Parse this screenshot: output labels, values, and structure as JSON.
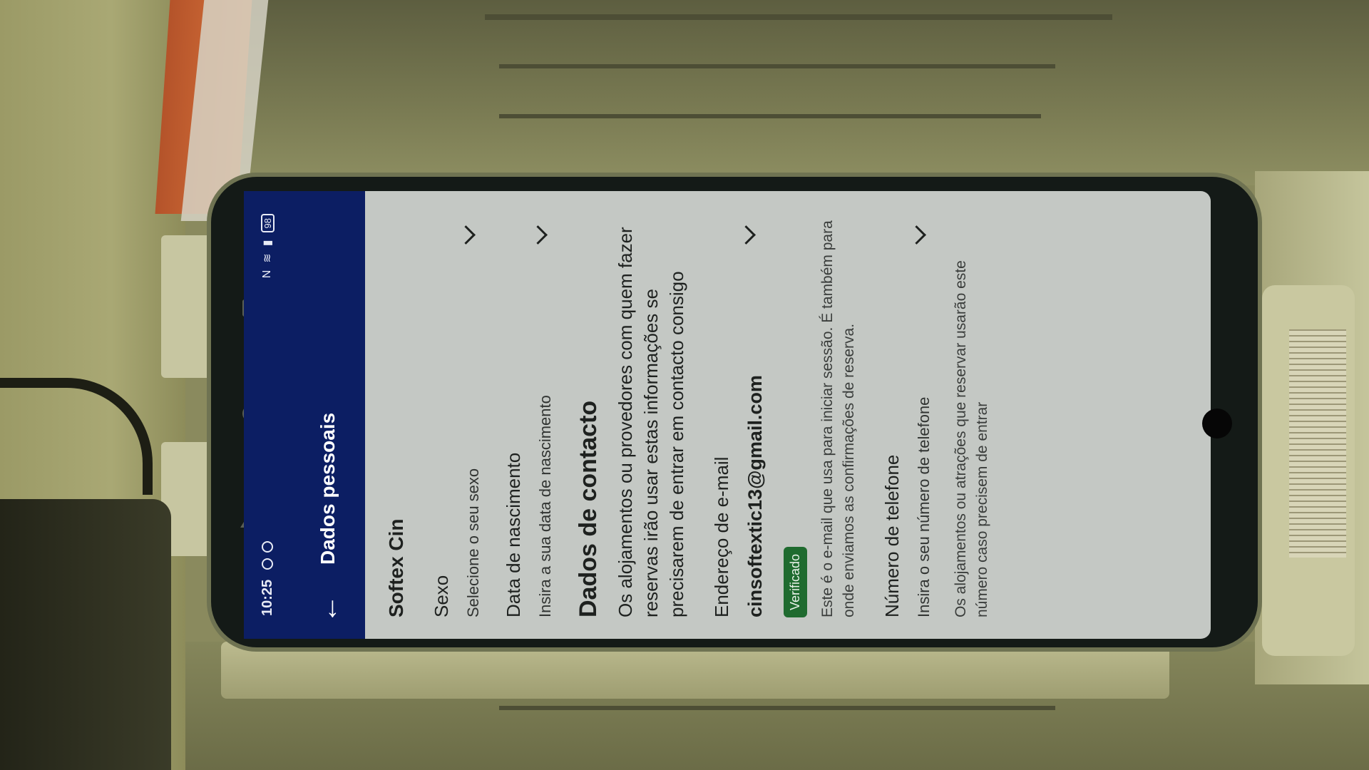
{
  "status_bar": {
    "time": "10:25",
    "battery": "98"
  },
  "app_bar": {
    "title": "Dados pessoais",
    "back_icon": "arrow-left-icon"
  },
  "profile": {
    "name": "Softex Cin"
  },
  "fields": {
    "gender": {
      "label": "Sexo",
      "placeholder": "Selecione o seu sexo"
    },
    "birth_date": {
      "label": "Data de nascimento",
      "placeholder": "Insira a sua data de nascimento"
    }
  },
  "contact": {
    "title": "Dados de contacto",
    "description": "Os alojamentos ou provedores com quem fazer reservas irão usar estas informações se precisarem de entrar em contacto consigo",
    "email": {
      "label": "Endereço de e-mail",
      "value": "cinsoftextic13@gmail.com",
      "badge": "Verificado",
      "helper": "Este é o e-mail que usa para iniciar sessão. É também para onde enviamos as confirmações de reserva."
    },
    "phone": {
      "label": "Número de telefone",
      "placeholder": "Insira o seu número de telefone",
      "helper": "Os alojamentos ou atrações que reservar usarão este número caso precisem de entrar"
    }
  },
  "colors": {
    "app_bar": "#0c1e63",
    "content_bg": "#c4c8c4",
    "badge": "#1f6b2f"
  }
}
